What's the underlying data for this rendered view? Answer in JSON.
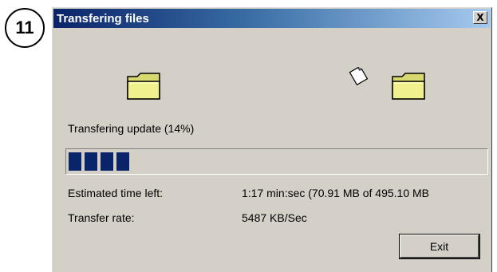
{
  "step": {
    "number": "11"
  },
  "window": {
    "title": "Transfering files",
    "close_glyph": "X"
  },
  "animation": {
    "source_icon": "folder-icon",
    "destination_icon": "folder-icon",
    "flying_icon": "paper-sheet-icon"
  },
  "status": {
    "label": "Transfering update (14%)",
    "progress_percent": 14,
    "progress_blocks_visible": 4
  },
  "details": {
    "time_label": "Estimated time left:",
    "time_value": "1:17 min:sec (70.91 MB of 495.10 MB",
    "rate_label": "Transfer rate:",
    "rate_value": "5487 KB/Sec"
  },
  "buttons": {
    "exit_label": "Exit"
  },
  "colors": {
    "titlebar_start": "#0a246a",
    "titlebar_end": "#a6caf0",
    "dialog_bg": "#d4d0c8",
    "progress_fill": "#0a246a",
    "folder_fill": "#f0f08c"
  }
}
